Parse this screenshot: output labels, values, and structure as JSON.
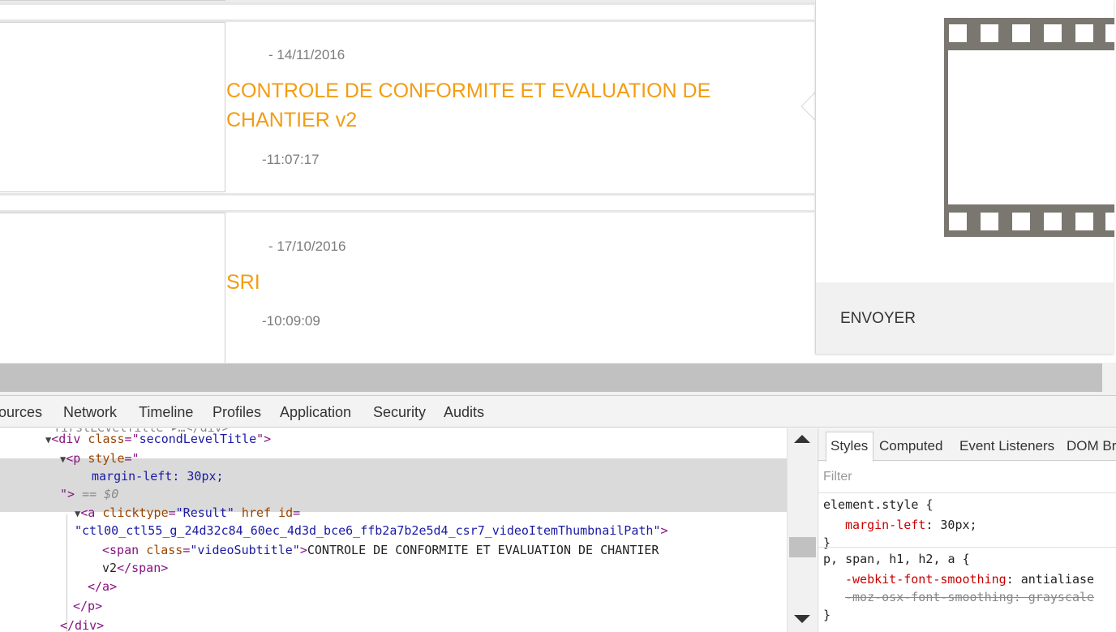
{
  "page": {
    "videos": [
      {
        "date": "- 14/11/2016",
        "title": "CONTROLE DE CONFORMITE ET EVALUATION DE CHANTIER v2",
        "time": "-11:07:17"
      },
      {
        "date": "- 17/10/2016",
        "title": "SRI",
        "time": "-10:09:09"
      }
    ],
    "side_panel": {
      "film_icon": "film-strip-icon",
      "send_label": "ENVOYER"
    },
    "colors": {
      "title": "#f39c12",
      "meta": "#7b7b7b",
      "film": "#7a7670"
    }
  },
  "devtools": {
    "tabs": [
      "ources",
      "Network",
      "Timeline",
      "Profiles",
      "Application",
      "Security",
      "Audits"
    ],
    "dom_lines": {
      "l0_text": "firstLevelTitle ▸…</div>",
      "l1_tag_open": "<div ",
      "l1_attr": "class",
      "l1_eq": "=\"",
      "l1_val": "secondLevelTitle",
      "l1_close": "\">",
      "l2_tag": "<p ",
      "l2_attr": "style",
      "l2_eq": "=\"",
      "l3_style": "margin-left: 30px;",
      "l4_close": "\">",
      "l4_sel": " == $0",
      "l5_tag": "<a ",
      "l5_attr1": "clicktype",
      "l5_val1": "\"Result\"",
      "l5_attr2": " href id",
      "l5_eq": "=",
      "l6_val": "\"ctl00_ctl55_g_24d32c84_60ec_4d3d_bce6_ffb2a7b2e5d4_csr7_videoItemThumbnailPath\"",
      "l6_close": ">",
      "l7_tag": "<span ",
      "l7_attr": "class",
      "l7_val": "\"videoSubtitle\"",
      "l7_close": ">",
      "l7_text": "CONTROLE DE CONFORMITE ET EVALUATION DE CHANTIER",
      "l8_text": "v2",
      "l8_close": "</span>",
      "l9_close": "</a>",
      "l10_close": "</p>",
      "l11_close": "</div>"
    },
    "styles": {
      "tabs": [
        "Styles",
        "Computed",
        "Event Listeners",
        "DOM Br"
      ],
      "filter_placeholder": "Filter",
      "rule1_selector": "element.style {",
      "rule1_prop": "margin-left",
      "rule1_value": ": 30px;",
      "rule1_close": "}",
      "rule2_selector": "p, span, h1, h2, a {",
      "rule2_prop1": "-webkit-font-smoothing",
      "rule2_value1": ": antialiase",
      "rule2_prop2": "-moz-osx-font-smoothing",
      "rule2_value2": ": grayscale",
      "rule2_close": "}"
    }
  }
}
